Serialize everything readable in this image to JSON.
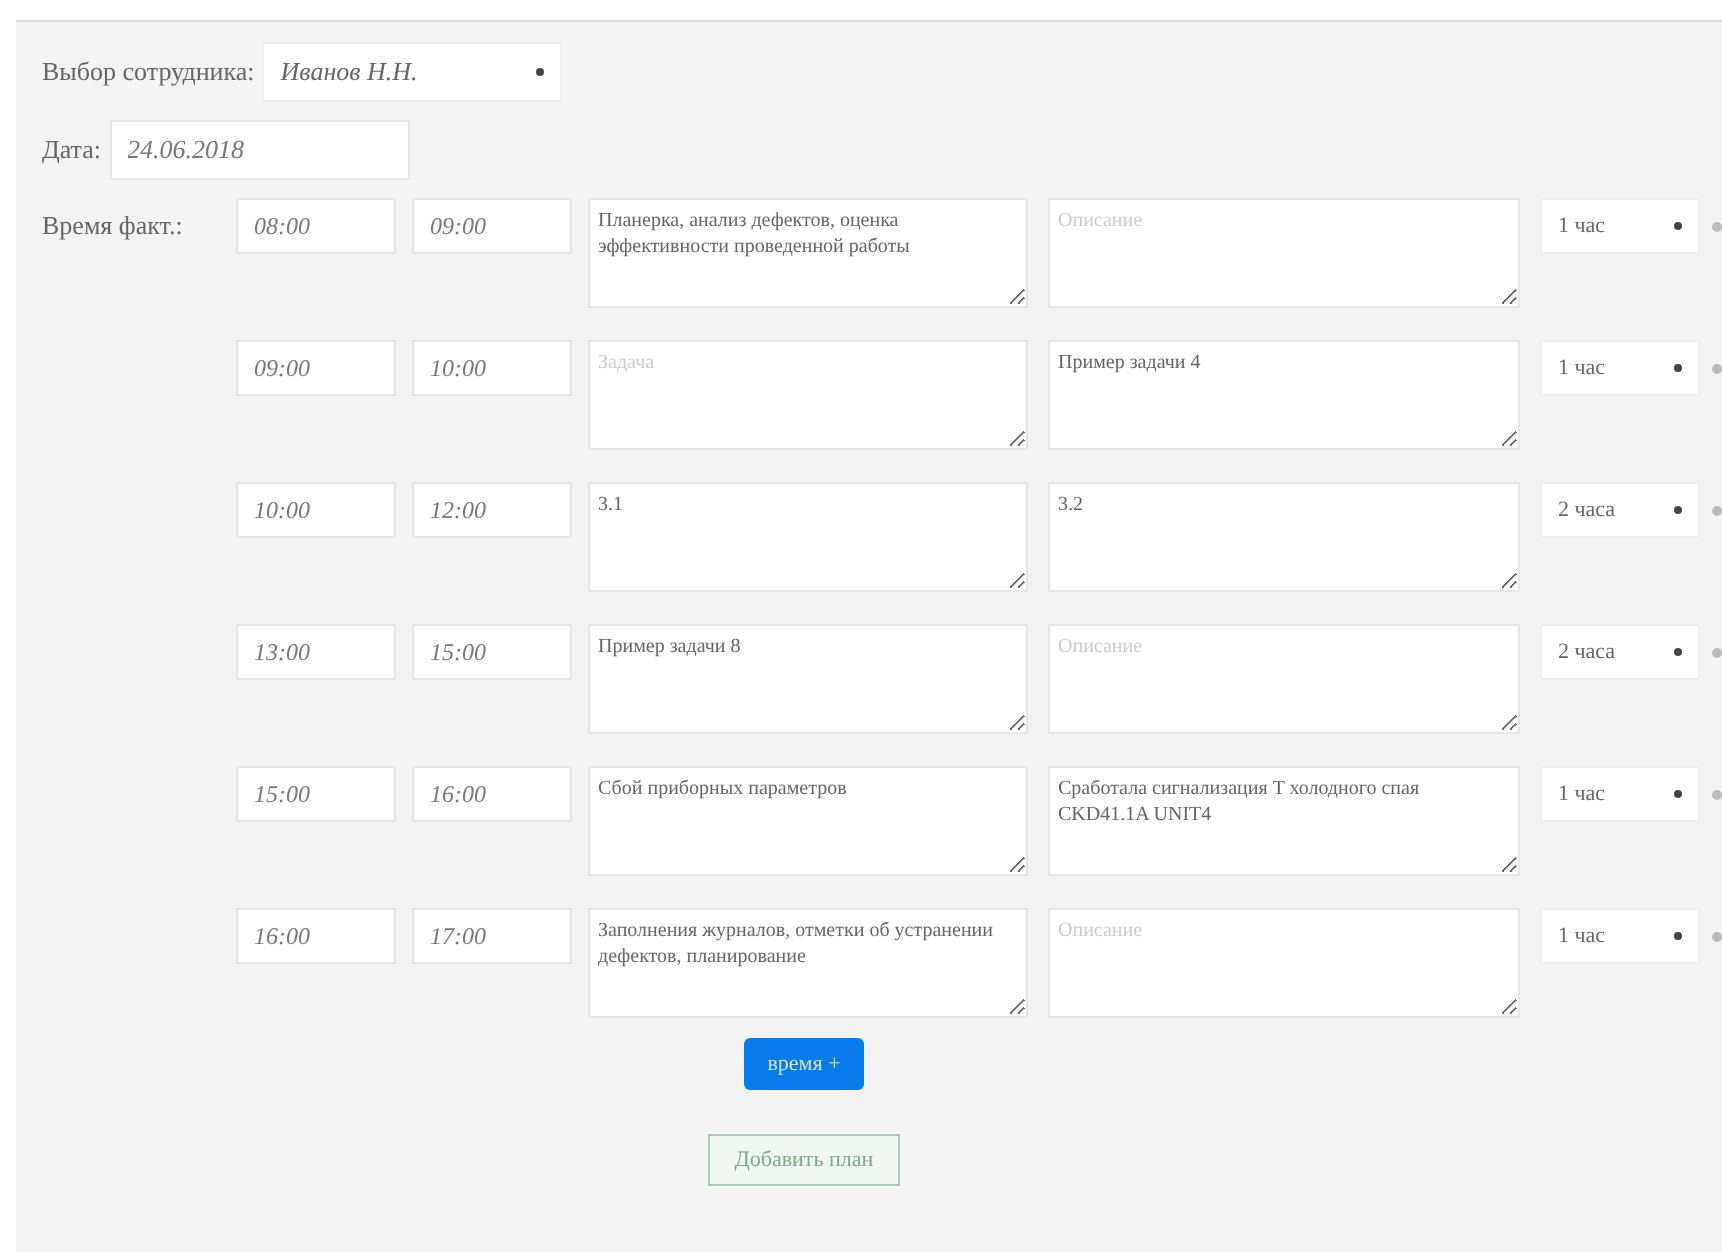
{
  "employee": {
    "label": "Выбор сотрудника:",
    "value": "Иванов Н.Н."
  },
  "date": {
    "label": "Дата:",
    "value": "24.06.2018"
  },
  "time_label": "Время факт.:",
  "rows": [
    {
      "start": "08:00",
      "end": "09:00",
      "task": {
        "value": "Планерка, анализ дефектов, оценка эффективности проведенной работы"
      },
      "description": {
        "placeholder": "Описание"
      },
      "duration": "1 час"
    },
    {
      "start": "09:00",
      "end": "10:00",
      "task": {
        "placeholder": "Задача"
      },
      "description": {
        "value": "Пример задачи 4"
      },
      "duration": "1 час"
    },
    {
      "start": "10:00",
      "end": "12:00",
      "task": {
        "value": "3.1"
      },
      "description": {
        "value": "3.2"
      },
      "duration": "2 часа"
    },
    {
      "start": "13:00",
      "end": "15:00",
      "task": {
        "value": "Пример задачи 8"
      },
      "description": {
        "placeholder": "Описание"
      },
      "duration": "2 часа"
    },
    {
      "start": "15:00",
      "end": "16:00",
      "task": {
        "value": "Сбой приборных параметров"
      },
      "description": {
        "value": "Сработала сигнализация T холодного спая CKD41.1A UNIT4"
      },
      "duration": "1 час"
    },
    {
      "start": "16:00",
      "end": "17:00",
      "task": {
        "value": "Заполнения журналов, отметки об устранении дефектов, планирование"
      },
      "description": {
        "placeholder": "Описание"
      },
      "duration": "1 час"
    }
  ],
  "add_time_button": "время +",
  "add_plan_button": "Добавить план"
}
